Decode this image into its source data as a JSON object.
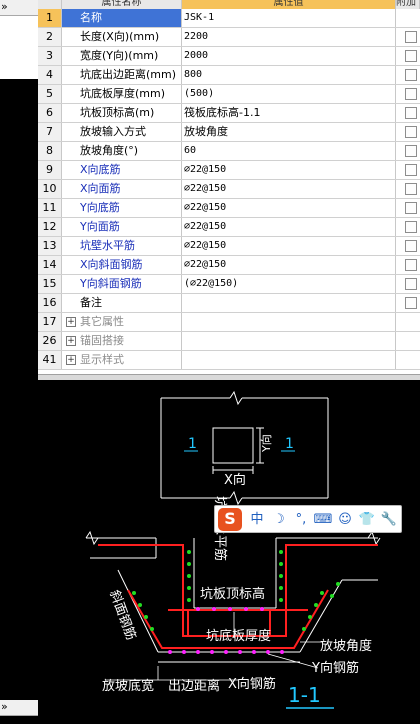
{
  "left_panel": {
    "top_arrow": "»",
    "bottom_arrow": "»"
  },
  "grid": {
    "headers": {
      "name": "属性名称",
      "value": "属性值",
      "extra": "附加"
    },
    "rows": [
      {
        "num": "1",
        "name": "名称",
        "value": "JSK-1",
        "style": "sel",
        "check": false
      },
      {
        "num": "2",
        "name": "长度(X向)(mm)",
        "value": "2200",
        "style": "",
        "check": true
      },
      {
        "num": "3",
        "name": "宽度(Y向)(mm)",
        "value": "2000",
        "style": "",
        "check": true
      },
      {
        "num": "4",
        "name": "坑底出边距离(mm)",
        "value": "800",
        "style": "",
        "check": true
      },
      {
        "num": "5",
        "name": "坑底板厚度(mm)",
        "value": "(500)",
        "style": "",
        "check": true
      },
      {
        "num": "6",
        "name": "坑板顶标高(m)",
        "value": "筏板底标高-1.1",
        "style": "",
        "check": true
      },
      {
        "num": "7",
        "name": "放坡输入方式",
        "value": "放坡角度",
        "style": "",
        "check": true
      },
      {
        "num": "8",
        "name": "放坡角度(°)",
        "value": "60",
        "style": "",
        "check": true
      },
      {
        "num": "9",
        "name": "X向底筋",
        "value": "⌀22@150",
        "style": "blue",
        "check": true
      },
      {
        "num": "10",
        "name": "X向面筋",
        "value": "⌀22@150",
        "style": "blue",
        "check": true
      },
      {
        "num": "11",
        "name": "Y向底筋",
        "value": "⌀22@150",
        "style": "blue",
        "check": true
      },
      {
        "num": "12",
        "name": "Y向面筋",
        "value": "⌀22@150",
        "style": "blue",
        "check": true
      },
      {
        "num": "13",
        "name": "坑壁水平筋",
        "value": "⌀22@150",
        "style": "blue",
        "check": true
      },
      {
        "num": "14",
        "name": "X向斜面钢筋",
        "value": "⌀22@150",
        "style": "blue",
        "check": true
      },
      {
        "num": "15",
        "name": "Y向斜面钢筋",
        "value": "(⌀22@150)",
        "style": "blue",
        "check": true
      },
      {
        "num": "16",
        "name": "备注",
        "value": "",
        "style": "",
        "check": true
      },
      {
        "num": "17",
        "name": "其它属性",
        "value": "",
        "style": "group",
        "check": false
      },
      {
        "num": "26",
        "name": "锚固搭接",
        "value": "",
        "style": "group",
        "check": false
      },
      {
        "num": "41",
        "name": "显示样式",
        "value": "",
        "style": "group",
        "check": false
      }
    ]
  },
  "diagram": {
    "plan": {
      "x_label": "X向",
      "y_label": "Y向",
      "section_mark": "1"
    },
    "section": {
      "labels": {
        "wall_horizontal": "坑壁水平筋",
        "pit_top_elev": "坑板顶标高",
        "bottom_thickness": "坑底板厚度",
        "slope_angle": "放坡角度",
        "y_rebar": "Y向钢筋",
        "x_rebar": "X向钢筋",
        "slope_bottom_width": "放坡底宽",
        "edge_distance": "出边距离",
        "slope_rebar": "斜面钢筋",
        "section_title": "1-1"
      }
    }
  },
  "ime_toolbar": {
    "logo": "S",
    "mode": "中",
    "items": [
      "☽",
      "°,",
      "⌨",
      "☺",
      "👕",
      "🔧"
    ]
  },
  "colors": {
    "selected_row": "#3f73d6",
    "header_value": "#f6c25a",
    "blue_text": "#1a2fb8",
    "rebar_red": "#ff2020",
    "rebar_green": "#22dd22",
    "rebar_magenta": "#ff22ff",
    "label_cyan": "#22c8ff"
  }
}
